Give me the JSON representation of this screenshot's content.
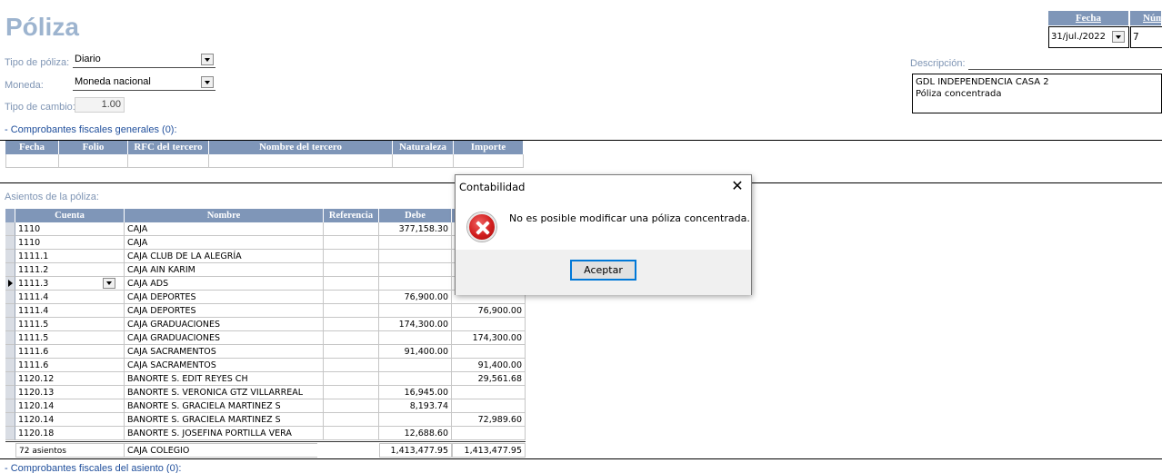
{
  "page": {
    "title": "Póliza"
  },
  "header": {
    "fecha_label": "Fecha",
    "fecha_value": "31/jul./2022",
    "numero_label": "Núm",
    "numero_value": "7"
  },
  "fields": {
    "tipo_label": "Tipo de póliza:",
    "tipo_value": "Diario",
    "moneda_label": "Moneda:",
    "moneda_value": "Moneda nacional",
    "cambio_label": "Tipo de cambio:",
    "cambio_value": "1.00",
    "descripcion_label": "Descripción:",
    "descripcion_line1": "GDL INDEPENDENCIA CASA 2",
    "descripcion_line2": "Póliza concentrada"
  },
  "fiscales": {
    "label": "- Comprobantes fiscales generales (0):",
    "columns": [
      "Fecha",
      "Folio",
      "RFC del tercero",
      "Nombre del tercero",
      "Naturaleza",
      "Importe"
    ]
  },
  "asientos": {
    "label": "Asientos de la póliza:",
    "columns": [
      "Cuenta",
      "Nombre",
      "Referencia",
      "Debe"
    ],
    "rows": [
      {
        "cuenta": "1110",
        "nombre": "CAJA",
        "referencia": "",
        "debe": "377,158.30",
        "haber": ""
      },
      {
        "cuenta": "1110",
        "nombre": "CAJA",
        "referencia": "",
        "debe": "",
        "haber": ""
      },
      {
        "cuenta": "1111.1",
        "nombre": "CAJA CLUB DE LA ALEGRÍA",
        "referencia": "",
        "debe": "",
        "haber": ""
      },
      {
        "cuenta": "1111.2",
        "nombre": "CAJA AIN KARIM",
        "referencia": "",
        "debe": "",
        "haber": ""
      },
      {
        "cuenta": "1111.3",
        "nombre": "CAJA ADS",
        "referencia": "",
        "debe": "",
        "haber": ""
      },
      {
        "cuenta": "1111.4",
        "nombre": "CAJA DEPORTES",
        "referencia": "",
        "debe": "76,900.00",
        "haber": ""
      },
      {
        "cuenta": "1111.4",
        "nombre": "CAJA DEPORTES",
        "referencia": "",
        "debe": "",
        "haber": "76,900.00"
      },
      {
        "cuenta": "1111.5",
        "nombre": "CAJA GRADUACIONES",
        "referencia": "",
        "debe": "174,300.00",
        "haber": ""
      },
      {
        "cuenta": "1111.5",
        "nombre": "CAJA GRADUACIONES",
        "referencia": "",
        "debe": "",
        "haber": "174,300.00"
      },
      {
        "cuenta": "1111.6",
        "nombre": "CAJA SACRAMENTOS",
        "referencia": "",
        "debe": "91,400.00",
        "haber": ""
      },
      {
        "cuenta": "1111.6",
        "nombre": "CAJA SACRAMENTOS",
        "referencia": "",
        "debe": "",
        "haber": "91,400.00"
      },
      {
        "cuenta": "1120.12",
        "nombre": "BANORTE S. EDIT REYES CH",
        "referencia": "",
        "debe": "",
        "haber": "29,561.68"
      },
      {
        "cuenta": "1120.13",
        "nombre": "BANORTE S. VERONICA GTZ VILLARREAL",
        "referencia": "",
        "debe": "16,945.00",
        "haber": ""
      },
      {
        "cuenta": "1120.14",
        "nombre": "BANORTE S. GRACIELA MARTINEZ S",
        "referencia": "",
        "debe": "8,193.74",
        "haber": ""
      },
      {
        "cuenta": "1120.14",
        "nombre": "BANORTE S. GRACIELA MARTINEZ S",
        "referencia": "",
        "debe": "",
        "haber": "72,989.60"
      },
      {
        "cuenta": "1120.18",
        "nombre": "BANORTE S. JOSEFINA PORTILLA VERA",
        "referencia": "",
        "debe": "12,688.60",
        "haber": ""
      }
    ],
    "footer": {
      "count": "72 asientos",
      "nombre": "CAJA COLEGIO",
      "total_debe": "1,413,477.95",
      "total_haber": "1,413,477.95"
    }
  },
  "bottom_label": "- Comprobantes fiscales del asiento (0):",
  "dialog": {
    "title": "Contabilidad",
    "message": "No es posible modificar una póliza concentrada.",
    "ok_label": "Aceptar"
  }
}
